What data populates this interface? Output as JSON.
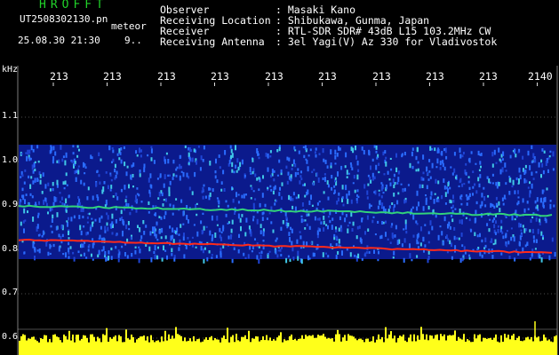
{
  "header": {
    "logo": "HROFFT",
    "file": "UT2508302130.pn",
    "meteor_tag": "meteor",
    "stamp": "25.08.30 21:30",
    "duration": "9..",
    "rows": [
      {
        "label": "Observer",
        "value": ": Masaki Kano"
      },
      {
        "label": "Receiving Location",
        "value": ": Shibukawa, Gunma, Japan"
      },
      {
        "label": "Receiver",
        "value": ": RTL-SDR SDR# 43dB L15 103.2MHz CW"
      },
      {
        "label": "Receiving Antenna",
        "value": ": 3el Yagi(V) Az 330 for Vladivostok"
      }
    ]
  },
  "axis": {
    "unit": "kHz",
    "x_ticks": [
      "213",
      "213",
      "213",
      "213",
      "213",
      "213",
      "213",
      "213",
      "213",
      "2140"
    ],
    "y_ticks": [
      "1.1",
      "1.0",
      "0.9",
      "0.8",
      "0.7",
      "0.6"
    ]
  },
  "colors": {
    "background": "#000000",
    "grid": "#9a9a9a",
    "spectrum_low": "#0b1a8c",
    "spectrum_mid": "#2a6cff",
    "carrier": "#32d27a",
    "meteor": "#ff2a1a",
    "signal_strip": "#ffff1a"
  }
}
